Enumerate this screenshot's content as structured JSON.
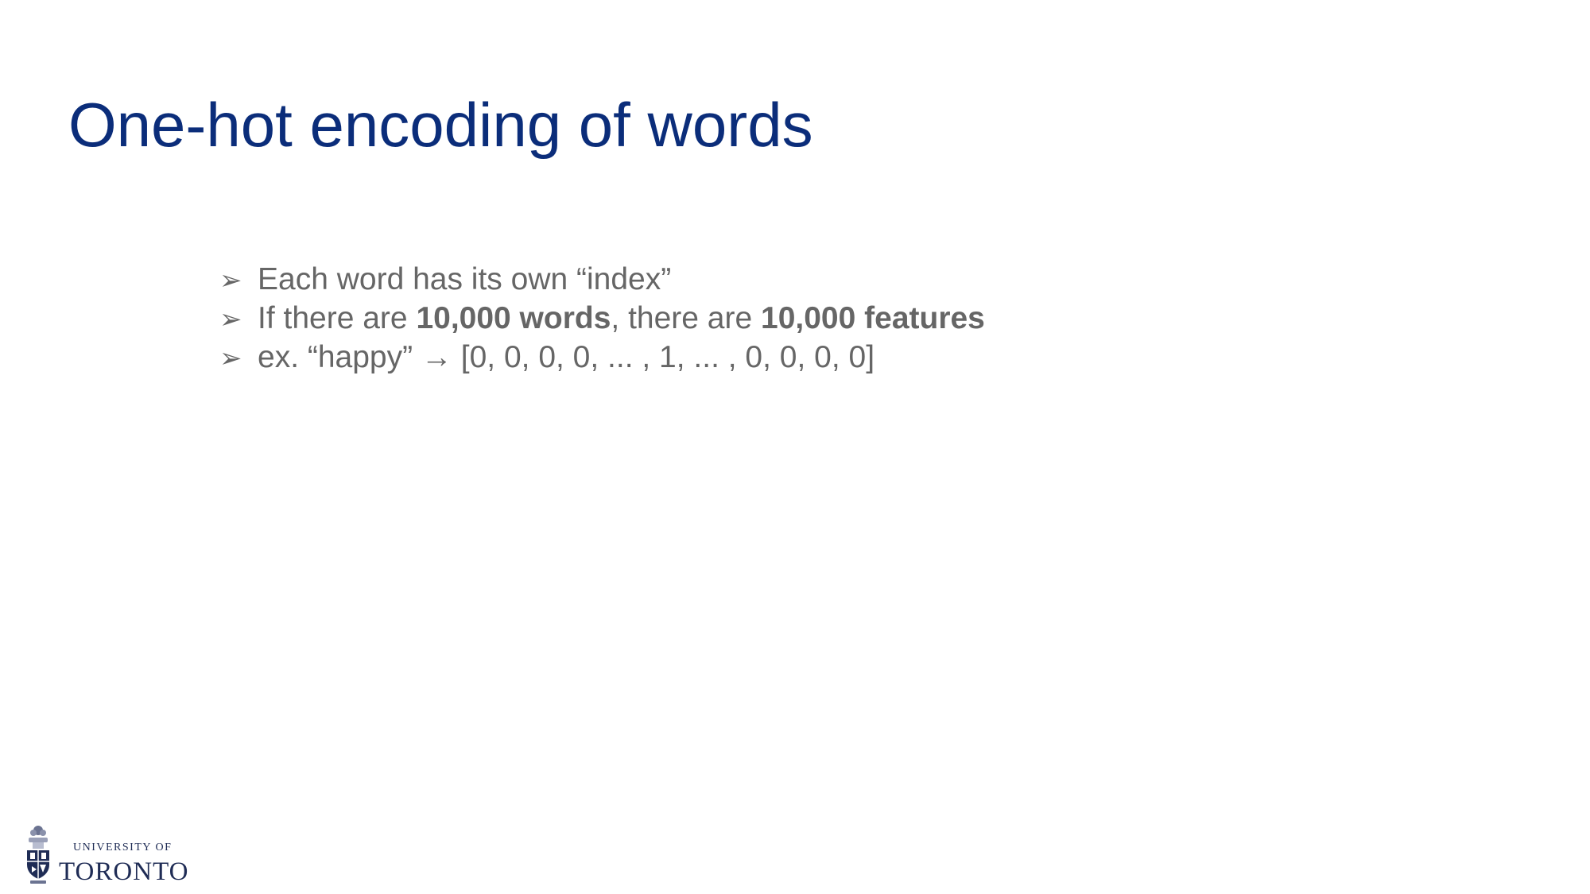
{
  "slide": {
    "title": "One-hot encoding of words",
    "bullet_marker": "➢",
    "bullets": [
      {
        "text": "Each word has its own “index”"
      },
      {
        "prefix": "If there are ",
        "bold1": "10,000 words",
        "middle": ", there are ",
        "bold2": "10,000 features"
      },
      {
        "text": "ex. “happy” →  [0, 0, 0, 0, ... , 1, ... , 0, 0, 0, 0]"
      }
    ]
  },
  "logo": {
    "line1": "UNIVERSITY OF",
    "line2": "TORONTO",
    "icon": "university-crest-icon"
  },
  "colors": {
    "title": "#0b2d7a",
    "body_text": "#666666",
    "logo": "#1f2c55",
    "background": "#ffffff"
  }
}
